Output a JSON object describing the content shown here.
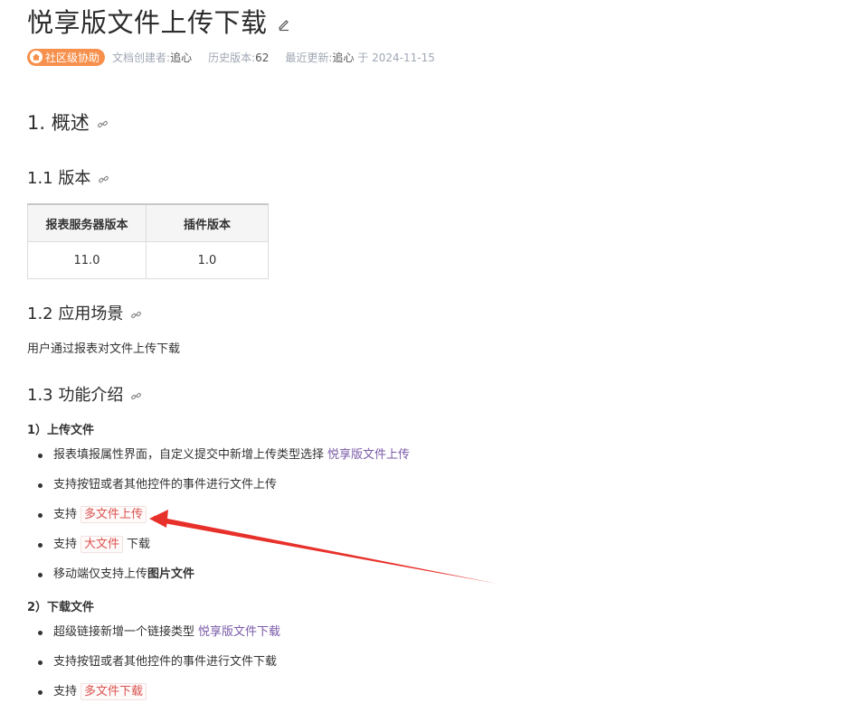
{
  "doc": {
    "title": "悦享版文件上传下载",
    "badge": "社区级协助",
    "creator_label": "文档创建者:",
    "creator": "追心",
    "history_label": "历史版本:",
    "history": "62",
    "updated_label": "最近更新:",
    "updated_by": "追心",
    "updated_on": "于 2024-11-15"
  },
  "sections": {
    "s1": "1. 概述",
    "s11": "1.1 版本",
    "s12": "1.2 应用场景",
    "s12_text": "用户通过报表对文件上传下载",
    "s13": "1.3 功能介绍"
  },
  "version_table": {
    "headers": [
      "报表服务器版本",
      "插件版本"
    ],
    "rows": [
      [
        "11.0",
        "1.0"
      ]
    ]
  },
  "upload": {
    "heading": "1）上传文件",
    "i1_text": "报表填报属性界面，自定义提交中新增上传类型选择",
    "i1_link": "悦享版文件上传",
    "i2_text": "支持按钮或者其他控件的事件进行文件上传",
    "i3_pre": "支持",
    "i3_code": "多文件上传",
    "i4_pre": "支持",
    "i4_code": "大文件",
    "i4_post": "下载",
    "i5_pre": "移动端仅支持上传",
    "i5_bold": "图片文件"
  },
  "download": {
    "heading": "2）下载文件",
    "i1_text": "超级链接新增一个链接类型",
    "i1_link": "悦享版文件下载",
    "i2_text": "支持按钮或者其他控件的事件进行文件下载",
    "i3_pre": "支持",
    "i3_code": "多文件下载"
  },
  "colors": {
    "badge": "#f7904c",
    "link": "#7a5aa8",
    "code": "#d9534f",
    "annotation_arrow": "#e8302a"
  }
}
